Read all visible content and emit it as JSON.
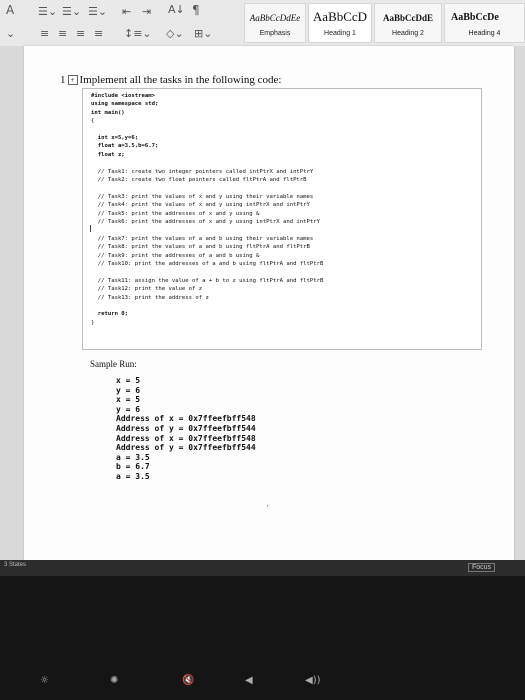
{
  "ribbon": {
    "paragraph_tools": [
      "bullet-list",
      "numbered-list",
      "multilevel-list",
      "decrease-indent",
      "increase-indent",
      "sort",
      "pilcrow",
      "align-left",
      "align-center",
      "align-right",
      "justify",
      "line-spacing",
      "shading",
      "borders"
    ],
    "sort_glyph": "A↓",
    "pilcrow_glyph": "¶",
    "styles": [
      {
        "sample": "AaBbCcDdEe",
        "name": "Emphasis"
      },
      {
        "sample": "AaBbCcD",
        "name": "Heading 1"
      },
      {
        "sample": "AaBbCcDdE",
        "name": "Heading 2"
      },
      {
        "sample": "AaBbCcDe",
        "name": "Heading 4"
      }
    ]
  },
  "document": {
    "question_number": "1",
    "question_text": "Implement all the tasks in the following code:",
    "code": [
      "#include <iostream>",
      "using namespace std;",
      "int main()",
      "{",
      "",
      "  int x=5,y=6;",
      "  float a=3.5,b=6.7;",
      "  float z;",
      "",
      "  // Task1: create two integer pointers called intPtrX and intPtrY",
      "  // Task2: create two float pointers called fltPtrA and fltPtrB",
      "",
      "  // Task3: print the values of x and y using their variable names",
      "  // Task4: print the values of x and y using intPtrX and intPtrY",
      "  // Task5: print the addresses of x and y using &",
      "  // Task6: print the addresses of x and y using intPtrX and intPtrY",
      "",
      "  // Task7: print the values of a and b using their variable names",
      "  // Task8: print the values of a and b using fltPtrA and fltPtrB",
      "  // Task9: print the addresses of a and b using &",
      "  // Task10: print the addresses of a and b using fltPtrA and fltPtrB",
      "",
      "  // Task11: assign the value of a + b to z using fltPtrA and fltPtrB",
      "  // Task12: print the value of z",
      "  // Task13: print the address of z",
      "",
      "  return 0;",
      "}"
    ],
    "sample_run_label": "Sample Run:",
    "sample_output": [
      "x = 5",
      "y = 6",
      "x = 5",
      "y = 6",
      "Address of x = 0x7ffeefbff548",
      "Address of y = 0x7ffeefbff544",
      "Address of x = 0x7ffeefbff548",
      "Address of y = 0x7ffeefbff544",
      "a = 3.5",
      "b = 6.7",
      "a = 3.5"
    ]
  },
  "status_bar": {
    "left_text": "3 States",
    "focus_label": "Focus"
  },
  "colors": {
    "ribbon_bg": "#e9e9e9",
    "canvas_bg": "#d9d9d9",
    "page_bg": "#fdfdfd",
    "code_box_border": "#bdbdbd"
  }
}
